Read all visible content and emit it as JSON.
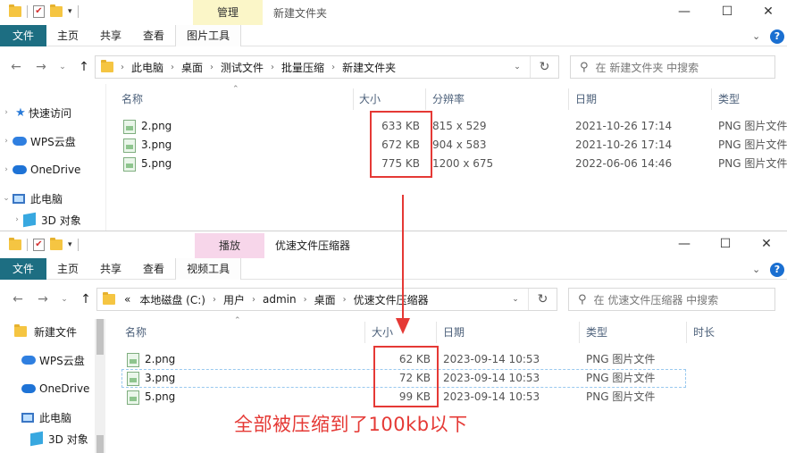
{
  "window1": {
    "title": "新建文件夹",
    "context_tab_group": "管理",
    "context_tab_group_color": "#fbf6c8",
    "ribbon_tabs": [
      "文件",
      "主页",
      "共享",
      "查看",
      "图片工具"
    ],
    "breadcrumb": [
      "此电脑",
      "桌面",
      "测试文件",
      "批量压缩",
      "新建文件夹"
    ],
    "search_placeholder": "在 新建文件夹 中搜索",
    "nav": [
      "快速访问",
      "WPS云盘",
      "OneDrive",
      "此电脑",
      "3D 对象"
    ],
    "columns": [
      "名称",
      "大小",
      "分辨率",
      "日期",
      "类型"
    ],
    "files": [
      {
        "name": "2.png",
        "size": "633 KB",
        "resolution": "815 x 529",
        "date": "2021-10-26 17:14",
        "type": "PNG 图片文件"
      },
      {
        "name": "3.png",
        "size": "672 KB",
        "resolution": "904 x 583",
        "date": "2021-10-26 17:14",
        "type": "PNG 图片文件"
      },
      {
        "name": "5.png",
        "size": "775 KB",
        "resolution": "1200 x 675",
        "date": "2022-06-06 14:46",
        "type": "PNG 图片文件"
      }
    ]
  },
  "window2": {
    "title": "优速文件压缩器",
    "context_tab_group": "播放",
    "context_tab_group_color": "#f7d6ea",
    "ribbon_tabs": [
      "文件",
      "主页",
      "共享",
      "查看",
      "视频工具"
    ],
    "breadcrumb_prefix": "«",
    "breadcrumb": [
      "本地磁盘 (C:)",
      "用户",
      "admin",
      "桌面",
      "优速文件压缩器"
    ],
    "search_placeholder": "在 优速文件压缩器 中搜索",
    "nav": [
      "新建文件",
      "WPS云盘",
      "OneDrive",
      "此电脑",
      "3D 对象"
    ],
    "columns": [
      "名称",
      "大小",
      "日期",
      "类型",
      "时长"
    ],
    "files": [
      {
        "name": "2.png",
        "size": "62 KB",
        "date": "2023-09-14 10:53",
        "type": "PNG 图片文件"
      },
      {
        "name": "3.png",
        "size": "72 KB",
        "date": "2023-09-14 10:53",
        "type": "PNG 图片文件"
      },
      {
        "name": "5.png",
        "size": "99 KB",
        "date": "2023-09-14 10:53",
        "type": "PNG 图片文件"
      }
    ]
  },
  "annotation": {
    "text": "全部被压缩到了100kb以下",
    "color": "#e53935"
  },
  "colors": {
    "file_tab": "#1d6e82",
    "help_button": "#1a6fd1",
    "highlight_box": "#e53935"
  }
}
